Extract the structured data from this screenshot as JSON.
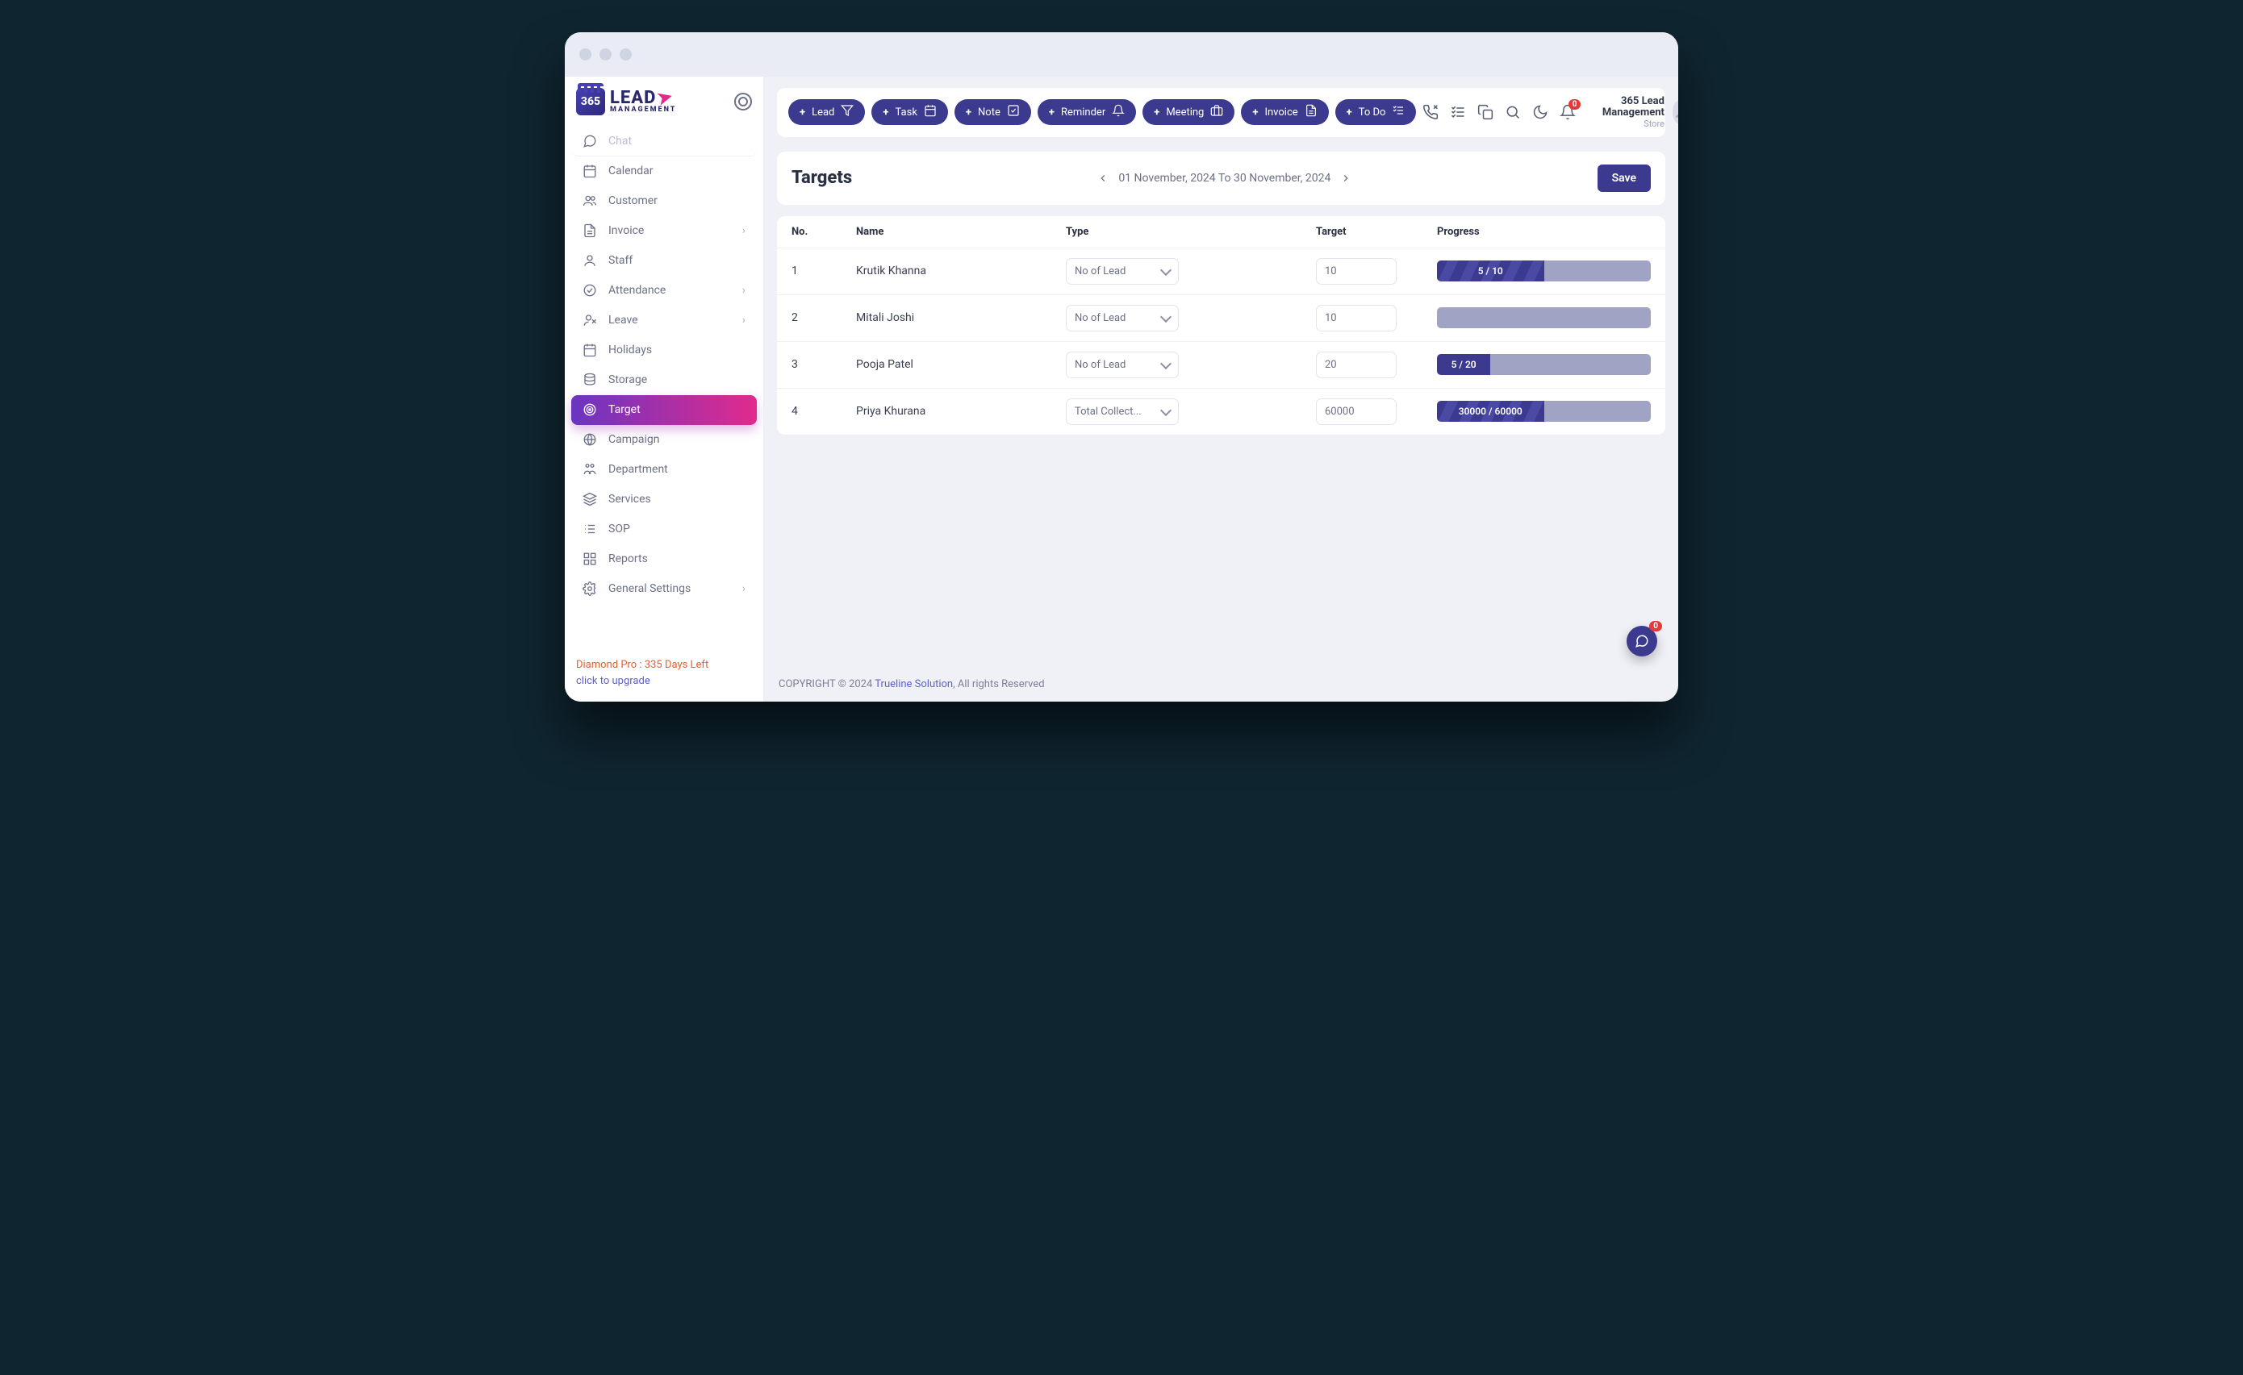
{
  "brand": {
    "mark": "365",
    "word1": "LEAD",
    "word2": "MANAGEMENT"
  },
  "sidebar": {
    "items": [
      {
        "label": "Chat",
        "icon": "chat",
        "faded": true
      },
      {
        "label": "Calendar",
        "icon": "calendar"
      },
      {
        "label": "Customer",
        "icon": "users"
      },
      {
        "label": "Invoice",
        "icon": "file",
        "expand": true
      },
      {
        "label": "Staff",
        "icon": "person"
      },
      {
        "label": "Attendance",
        "icon": "check-circle",
        "expand": true
      },
      {
        "label": "Leave",
        "icon": "person-x",
        "expand": true
      },
      {
        "label": "Holidays",
        "icon": "calendar"
      },
      {
        "label": "Storage",
        "icon": "db"
      },
      {
        "label": "Target",
        "icon": "target",
        "active": true
      },
      {
        "label": "Campaign",
        "icon": "globe"
      },
      {
        "label": "Department",
        "icon": "dept"
      },
      {
        "label": "Services",
        "icon": "stack"
      },
      {
        "label": "SOP",
        "icon": "sop"
      },
      {
        "label": "Reports",
        "icon": "grid"
      },
      {
        "label": "General Settings",
        "icon": "gear",
        "expand": true
      }
    ],
    "plan_line": "Diamond Pro : 335 Days Left",
    "upgrade": "click to upgrade"
  },
  "toolbar": {
    "pills": [
      {
        "label": "Lead",
        "icon": "filter"
      },
      {
        "label": "Task",
        "icon": "calendar"
      },
      {
        "label": "Note",
        "icon": "note"
      },
      {
        "label": "Reminder",
        "icon": "bell"
      },
      {
        "label": "Meeting",
        "icon": "briefcase"
      },
      {
        "label": "Invoice",
        "icon": "file"
      },
      {
        "label": "To Do",
        "icon": "todo"
      }
    ],
    "notif_count": "0",
    "user_name": "365 Lead Management",
    "user_sub": "Store"
  },
  "targets": {
    "title": "Targets",
    "range": "01 November, 2024 To 30 November, 2024",
    "save": "Save",
    "headers": {
      "no": "No.",
      "name": "Name",
      "type": "Type",
      "target": "Target",
      "progress": "Progress"
    },
    "rows": [
      {
        "no": "1",
        "name": "Krutik Khanna",
        "type": "No of Lead",
        "target": "10",
        "progress_label": "5 / 10",
        "progress_pct": 50,
        "striped": true
      },
      {
        "no": "2",
        "name": "Mitali Joshi",
        "type": "No of Lead",
        "target": "10",
        "progress_label": "",
        "progress_pct": 0,
        "striped": false
      },
      {
        "no": "3",
        "name": "Pooja Patel",
        "type": "No of Lead",
        "target": "20",
        "progress_label": "5 / 20",
        "progress_pct": 25,
        "striped": false
      },
      {
        "no": "4",
        "name": "Priya Khurana",
        "type": "Total Collect...",
        "target": "60000",
        "progress_label": "30000 / 60000",
        "progress_pct": 50,
        "striped": true
      }
    ]
  },
  "footer": {
    "pre": "COPYRIGHT © 2024 ",
    "link": "Trueline Solution",
    "post": ", All rights Reserved"
  },
  "fab_count": "0"
}
